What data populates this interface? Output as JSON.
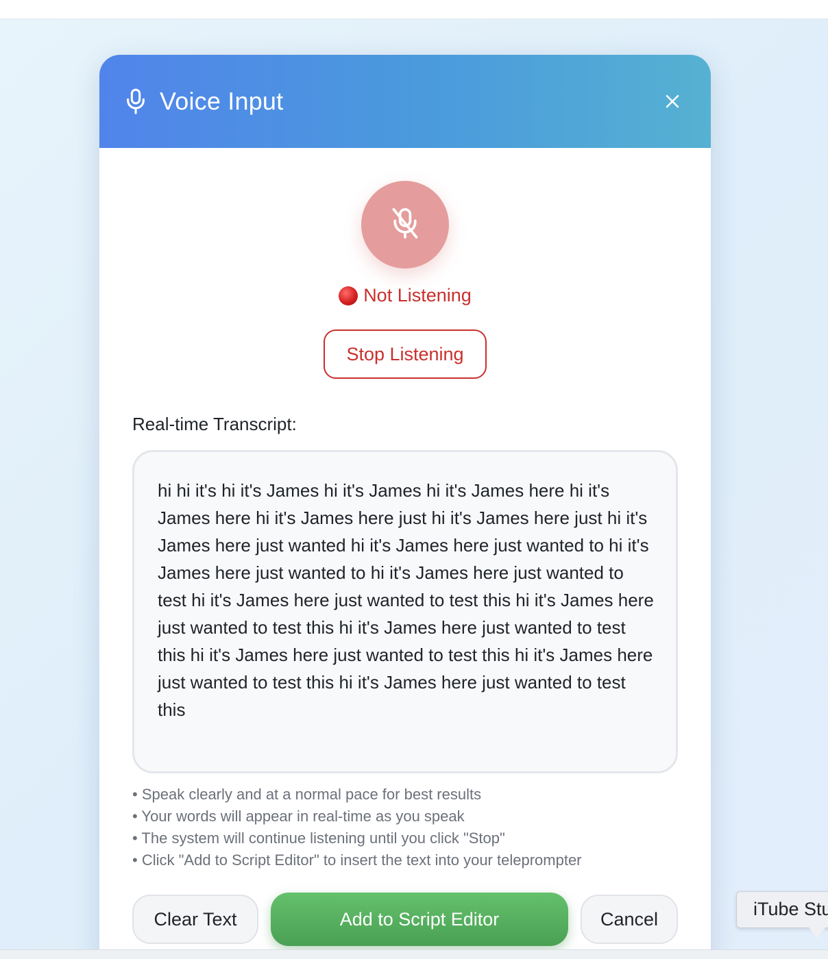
{
  "dialog": {
    "title": "Voice Input",
    "close_icon": "close-icon",
    "header_icon": "microphone-icon"
  },
  "mic": {
    "icon": "microphone-off-icon",
    "status_icon": "red-circle",
    "status_text": "Not Listening",
    "stop_label": "Stop Listening"
  },
  "transcript": {
    "label": "Real-time Transcript:",
    "text": "hi hi it's hi it's James hi it's James hi it's James here hi it's James here hi it's James here just hi it's James here just hi it's James here just wanted hi it's James here just wanted to hi it's James here just wanted to hi it's James here just wanted to test hi it's James here just wanted to test this hi it's James here just wanted to test this hi it's James here just wanted to test this hi it's James here just wanted to test this hi it's James here just wanted to test this hi it's James here just wanted to test this"
  },
  "tips": [
    "Speak clearly and at a normal pace for best results",
    "Your words will appear in real-time as you speak",
    "The system will continue listening until you click \"Stop\"",
    "Click \"Add to Script Editor\" to insert the text into your teleprompter"
  ],
  "buttons": {
    "clear": "Clear Text",
    "add": "Add to Script Editor",
    "cancel": "Cancel"
  },
  "tooltip": {
    "text": "iTube Studio"
  },
  "colors": {
    "header_start": "#5184ea",
    "header_end": "#56b1d2",
    "danger": "#c9302c",
    "mic_bg": "#e49d9c",
    "success": "#4aa054"
  }
}
